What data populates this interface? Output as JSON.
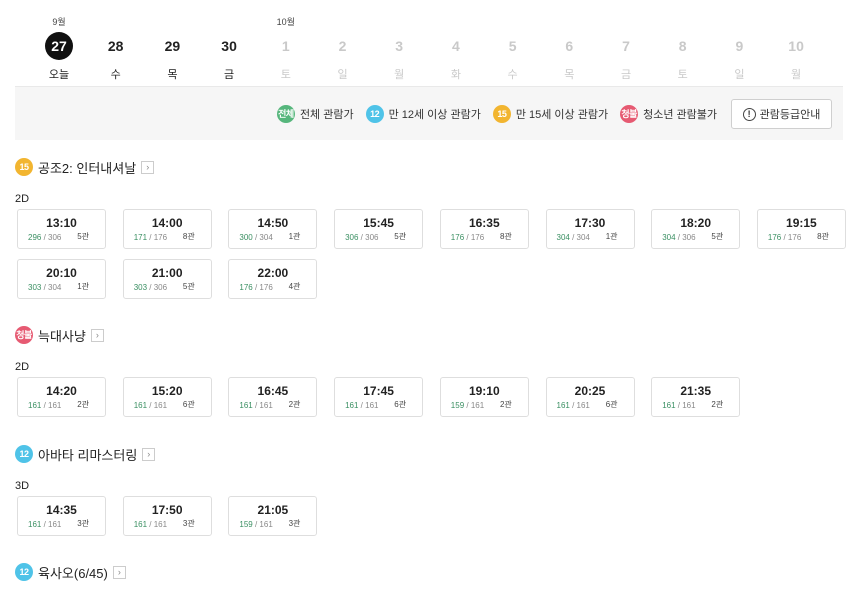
{
  "dates": [
    {
      "month": "9월",
      "day": "27",
      "weekday": "오늘",
      "state": "selected"
    },
    {
      "month": "",
      "day": "28",
      "weekday": "수",
      "state": "normal"
    },
    {
      "month": "",
      "day": "29",
      "weekday": "목",
      "state": "normal"
    },
    {
      "month": "",
      "day": "30",
      "weekday": "금",
      "state": "normal"
    },
    {
      "month": "10월",
      "day": "1",
      "weekday": "토",
      "state": "disabled"
    },
    {
      "month": "",
      "day": "2",
      "weekday": "일",
      "state": "disabled"
    },
    {
      "month": "",
      "day": "3",
      "weekday": "월",
      "state": "disabled"
    },
    {
      "month": "",
      "day": "4",
      "weekday": "화",
      "state": "disabled"
    },
    {
      "month": "",
      "day": "5",
      "weekday": "수",
      "state": "disabled"
    },
    {
      "month": "",
      "day": "6",
      "weekday": "목",
      "state": "disabled"
    },
    {
      "month": "",
      "day": "7",
      "weekday": "금",
      "state": "disabled"
    },
    {
      "month": "",
      "day": "8",
      "weekday": "토",
      "state": "disabled"
    },
    {
      "month": "",
      "day": "9",
      "weekday": "일",
      "state": "disabled"
    },
    {
      "month": "",
      "day": "10",
      "weekday": "월",
      "state": "disabled"
    }
  ],
  "legend": {
    "items": [
      {
        "badge": "전체",
        "label": "전체 관람가",
        "class": "all"
      },
      {
        "badge": "12",
        "label": "만 12세 이상 관람가",
        "class": "r12"
      },
      {
        "badge": "15",
        "label": "만 15세 이상 관람가",
        "class": "r15"
      },
      {
        "badge": "청불",
        "label": "청소년 관람불가",
        "class": "r18"
      }
    ],
    "guide_button": "관람등급안내",
    "guide_icon": "!"
  },
  "detail_icon": "›",
  "movies": [
    {
      "rating_badge": "15",
      "rating_class": "r15",
      "title": "공조2: 인터내셔날",
      "format": "2D",
      "showtimes": [
        {
          "time": "13:10",
          "remain": "296",
          "total": "306",
          "hall": "5관"
        },
        {
          "time": "14:00",
          "remain": "171",
          "total": "176",
          "hall": "8관"
        },
        {
          "time": "14:50",
          "remain": "300",
          "total": "304",
          "hall": "1관"
        },
        {
          "time": "15:45",
          "remain": "306",
          "total": "306",
          "hall": "5관"
        },
        {
          "time": "16:35",
          "remain": "176",
          "total": "176",
          "hall": "8관"
        },
        {
          "time": "17:30",
          "remain": "304",
          "total": "304",
          "hall": "1관"
        },
        {
          "time": "18:20",
          "remain": "304",
          "total": "306",
          "hall": "5관"
        },
        {
          "time": "19:15",
          "remain": "176",
          "total": "176",
          "hall": "8관"
        },
        {
          "time": "20:10",
          "remain": "303",
          "total": "304",
          "hall": "1관"
        },
        {
          "time": "21:00",
          "remain": "303",
          "total": "306",
          "hall": "5관"
        },
        {
          "time": "22:00",
          "remain": "176",
          "total": "176",
          "hall": "4관"
        }
      ]
    },
    {
      "rating_badge": "청불",
      "rating_class": "r18",
      "title": "늑대사냥",
      "format": "2D",
      "showtimes": [
        {
          "time": "14:20",
          "remain": "161",
          "total": "161",
          "hall": "2관"
        },
        {
          "time": "15:20",
          "remain": "161",
          "total": "161",
          "hall": "6관"
        },
        {
          "time": "16:45",
          "remain": "161",
          "total": "161",
          "hall": "2관"
        },
        {
          "time": "17:45",
          "remain": "161",
          "total": "161",
          "hall": "6관"
        },
        {
          "time": "19:10",
          "remain": "159",
          "total": "161",
          "hall": "2관"
        },
        {
          "time": "20:25",
          "remain": "161",
          "total": "161",
          "hall": "6관"
        },
        {
          "time": "21:35",
          "remain": "161",
          "total": "161",
          "hall": "2관"
        }
      ]
    },
    {
      "rating_badge": "12",
      "rating_class": "r12",
      "title": "아바타 리마스터링",
      "format": "3D",
      "showtimes": [
        {
          "time": "14:35",
          "remain": "161",
          "total": "161",
          "hall": "3관"
        },
        {
          "time": "17:50",
          "remain": "161",
          "total": "161",
          "hall": "3관"
        },
        {
          "time": "21:05",
          "remain": "159",
          "total": "161",
          "hall": "3관"
        }
      ]
    },
    {
      "rating_badge": "12",
      "rating_class": "r12",
      "title": "육사오(6/45)",
      "format": "",
      "showtimes": []
    }
  ]
}
